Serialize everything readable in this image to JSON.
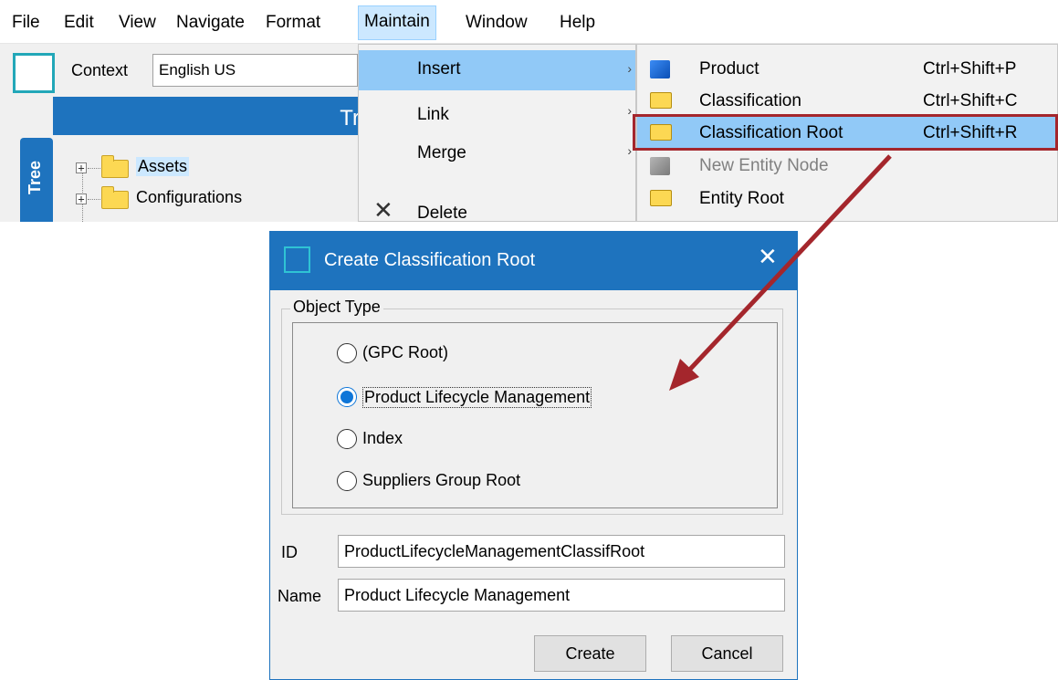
{
  "menubar": {
    "items": [
      "File",
      "Edit",
      "View",
      "Navigate",
      "Format",
      "Maintain",
      "Window",
      "Help"
    ],
    "active": "Maintain"
  },
  "context": {
    "label": "Context",
    "value": "English US"
  },
  "tree": {
    "header_fragment": "Tr",
    "tab_label": "Tree",
    "items": [
      {
        "label": "Assets",
        "selected": true
      },
      {
        "label": "Configurations",
        "selected": false
      }
    ]
  },
  "maintain_menu": {
    "items": [
      {
        "label": "Insert",
        "has_submenu": true,
        "highlighted": true
      },
      {
        "label": "Link",
        "has_submenu": true
      },
      {
        "label": "Merge",
        "has_submenu": true
      },
      {
        "label": "Delete",
        "icon": "delete-x-icon"
      }
    ]
  },
  "insert_submenu": {
    "items": [
      {
        "label": "Product",
        "shortcut": "Ctrl+Shift+P",
        "icon": "blue-cube-icon"
      },
      {
        "label": "Classification",
        "shortcut": "Ctrl+Shift+C",
        "icon": "folder-icon"
      },
      {
        "label": "Classification Root",
        "shortcut": "Ctrl+Shift+R",
        "icon": "folder-icon",
        "highlighted": true
      },
      {
        "label": "New Entity Node",
        "shortcut": "",
        "icon": "gray-cube-icon",
        "disabled": true
      },
      {
        "label": "Entity Root",
        "shortcut": "",
        "icon": "folder-icon"
      }
    ]
  },
  "dialog": {
    "title": "Create Classification Root",
    "object_type_legend": "Object Type",
    "options": [
      {
        "label": "(GPC Root)",
        "checked": false
      },
      {
        "label": "Product Lifecycle Management",
        "checked": true
      },
      {
        "label": "Index",
        "checked": false
      },
      {
        "label": "Suppliers Group Root",
        "checked": false
      }
    ],
    "id_label": "ID",
    "id_value": "ProductLifecycleManagementClassifRoot",
    "name_label": "Name",
    "name_value": "Product Lifecycle Management",
    "create_label": "Create",
    "cancel_label": "Cancel"
  },
  "colors": {
    "accent_blue": "#1e73be",
    "menu_highlight": "#91c9f7",
    "annotation_red": "#a4262c"
  }
}
